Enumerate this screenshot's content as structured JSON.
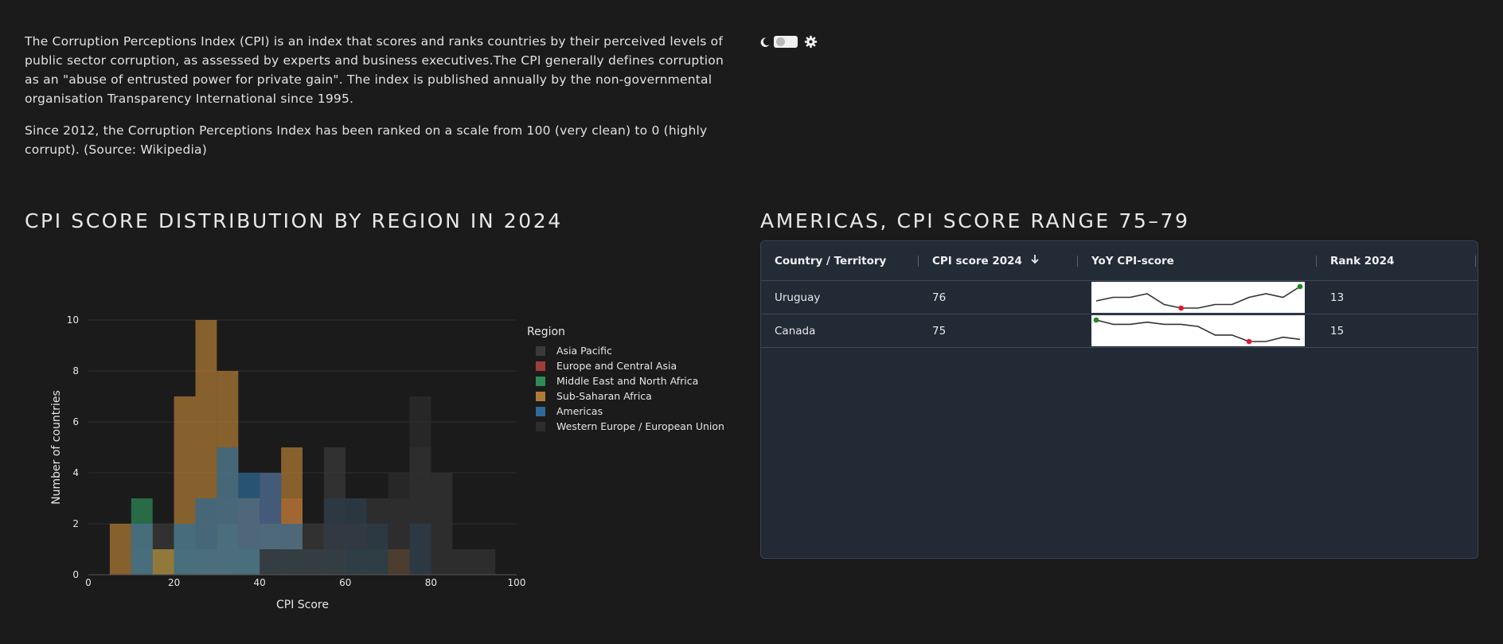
{
  "intro": {
    "p1": "The Corruption Perceptions Index (CPI) is an index that scores and ranks countries by their perceived levels of public sector corruption, as assessed by experts and business executives.The CPI generally defines corruption as an \"abuse of entrusted power for private gain\". The index is published annually by the non-governmental organisation Transparency International since 1995.",
    "p2": "Since 2012, the Corruption Perceptions Index has been ranked on a scale from 100 (very clean) to 0 (highly corrupt). (Source: Wikipedia)"
  },
  "theme_toggle": {
    "icons": [
      "moon-icon",
      "gear-icon"
    ],
    "state": "dark"
  },
  "left_title": "CPI SCORE DISTRIBUTION BY REGION IN 2024",
  "right_title": "AMERICAS, CPI SCORE RANGE 75–79",
  "chart_data": {
    "type": "bar",
    "subtype": "overlaid-histogram",
    "xlabel": "CPI Score",
    "ylabel": "Number of countries",
    "xlim": [
      0,
      100
    ],
    "ylim": [
      0,
      10
    ],
    "x_ticks": [
      0,
      20,
      40,
      60,
      80,
      100
    ],
    "y_ticks": [
      0,
      2,
      4,
      6,
      8,
      10
    ],
    "bin_width": 5,
    "grid": true,
    "legend_title": "Region",
    "legend_position": "right",
    "series": [
      {
        "name": "Asia Pacific",
        "color": "#3a3a3a",
        "bins": [
          [
            10,
            1
          ],
          [
            15,
            2
          ],
          [
            25,
            1
          ],
          [
            30,
            3
          ],
          [
            40,
            2
          ],
          [
            45,
            1
          ],
          [
            50,
            2
          ],
          [
            55,
            5
          ],
          [
            60,
            2
          ],
          [
            65,
            3
          ],
          [
            70,
            3
          ],
          [
            75,
            5
          ],
          [
            80,
            4
          ],
          [
            85,
            1
          ],
          [
            90,
            1
          ]
        ]
      },
      {
        "name": "Europe and Central Asia",
        "color": "#9e3d3a",
        "bins": [
          [
            15,
            1
          ],
          [
            20,
            1
          ],
          [
            25,
            1
          ],
          [
            30,
            2
          ],
          [
            35,
            3
          ],
          [
            40,
            4
          ],
          [
            45,
            3
          ],
          [
            50,
            1
          ],
          [
            55,
            2
          ],
          [
            60,
            2
          ],
          [
            65,
            1
          ],
          [
            70,
            1
          ]
        ]
      },
      {
        "name": "Middle East and North Africa",
        "color": "#2e8b57",
        "bins": [
          [
            10,
            3
          ],
          [
            15,
            1
          ],
          [
            20,
            2
          ],
          [
            25,
            1
          ],
          [
            30,
            2
          ],
          [
            35,
            1
          ],
          [
            45,
            1
          ],
          [
            55,
            1
          ],
          [
            60,
            1
          ],
          [
            65,
            1
          ]
        ]
      },
      {
        "name": "Sub-Saharan Africa",
        "color": "#b07c35",
        "bins": [
          [
            5,
            2
          ],
          [
            10,
            2
          ],
          [
            15,
            1
          ],
          [
            20,
            7
          ],
          [
            25,
            10
          ],
          [
            30,
            8
          ],
          [
            35,
            3
          ],
          [
            40,
            2
          ],
          [
            45,
            5
          ],
          [
            50,
            1
          ],
          [
            55,
            1
          ],
          [
            70,
            1
          ]
        ]
      },
      {
        "name": "Americas",
        "color": "#2e6a96",
        "bins": [
          [
            10,
            2
          ],
          [
            20,
            2
          ],
          [
            25,
            3
          ],
          [
            30,
            5
          ],
          [
            35,
            4
          ],
          [
            40,
            4
          ],
          [
            45,
            2
          ],
          [
            50,
            1
          ],
          [
            55,
            3
          ],
          [
            60,
            3
          ],
          [
            65,
            2
          ],
          [
            75,
            2
          ]
        ]
      },
      {
        "name": "Western Europe / European Union",
        "color": "#2d2d2d",
        "bins": [
          [
            40,
            1
          ],
          [
            45,
            1
          ],
          [
            50,
            1
          ],
          [
            55,
            3
          ],
          [
            60,
            3
          ],
          [
            65,
            3
          ],
          [
            70,
            4
          ],
          [
            75,
            7
          ],
          [
            80,
            4
          ],
          [
            85,
            1
          ],
          [
            90,
            1
          ]
        ]
      }
    ]
  },
  "table": {
    "columns": [
      "Country / Territory",
      "CPI score 2024",
      "YoY CPI-score",
      "Rank 2024"
    ],
    "sort_icon": "arrow-down-icon",
    "rows": [
      {
        "country": "Uruguay",
        "score": "76",
        "rank": "13",
        "trend": [
          72,
          73,
          73,
          74,
          71,
          70,
          70,
          71,
          71,
          73,
          74,
          73,
          76
        ],
        "min_index": 5,
        "max_index": 12
      },
      {
        "country": "Canada",
        "score": "75",
        "rank": "15",
        "trend": [
          84,
          82,
          82,
          83,
          82,
          82,
          81,
          77,
          77,
          74,
          74,
          76,
          75
        ],
        "min_index": 9,
        "max_index": 0
      }
    ]
  }
}
